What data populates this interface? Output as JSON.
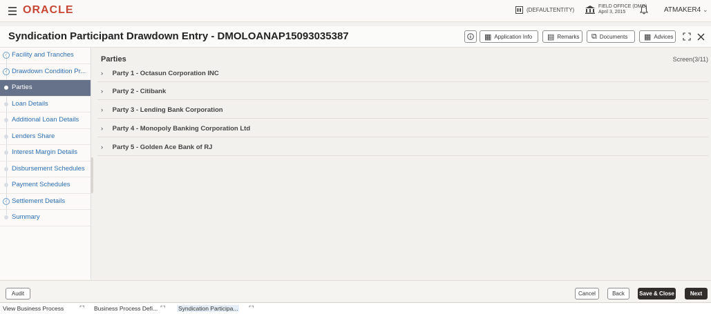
{
  "topbar": {
    "logo": "ORACLE",
    "entity": "(DEFAULTENTITY)",
    "office_name": "FIELD OFFICE (DMO)",
    "office_date": "April 3, 2015",
    "user": "ATMAKER4"
  },
  "header": {
    "title": "Syndication Participant Drawdown Entry - DMOLOANAP15093035387",
    "buttons": {
      "application_info": "Application Info",
      "remarks": "Remarks",
      "documents": "Documents",
      "advices": "Advices"
    }
  },
  "sidebar": {
    "items": [
      {
        "label": "Facility and Tranches",
        "state": "done"
      },
      {
        "label": "Drawdown Condition Pr...",
        "state": "done"
      },
      {
        "label": "Parties",
        "state": "active"
      },
      {
        "label": "Loan Details",
        "state": "pending"
      },
      {
        "label": "Additional Loan Details",
        "state": "pending"
      },
      {
        "label": "Lenders Share",
        "state": "pending"
      },
      {
        "label": "Interest Margin Details",
        "state": "pending"
      },
      {
        "label": "Disbursement Schedules",
        "state": "pending"
      },
      {
        "label": "Payment Schedules",
        "state": "pending"
      },
      {
        "label": "Settlement Details",
        "state": "done"
      },
      {
        "label": "Summary",
        "state": "pending"
      }
    ]
  },
  "main": {
    "section_title": "Parties",
    "screen_indicator": "Screen(3/11)",
    "parties": [
      "Party 1 - Octasun Corporation INC",
      "Party 2 - Citibank",
      "Party 3 - Lending Bank Corporation",
      "Party 4 - Monopoly Banking Corporation Ltd",
      "Party 5 - Golden Ace Bank of RJ"
    ]
  },
  "footer": {
    "audit": "Audit",
    "cancel": "Cancel",
    "back": "Back",
    "save_close": "Save & Close",
    "next": "Next"
  },
  "taskbar": {
    "tasks": [
      "View Business Process",
      "Business Process Defi...",
      "Syndication Participa..."
    ]
  },
  "colors": {
    "brand": "#c74634",
    "active_nav": "#66728a",
    "primary_button": "#312d2a",
    "link": "#2d6fb2"
  }
}
